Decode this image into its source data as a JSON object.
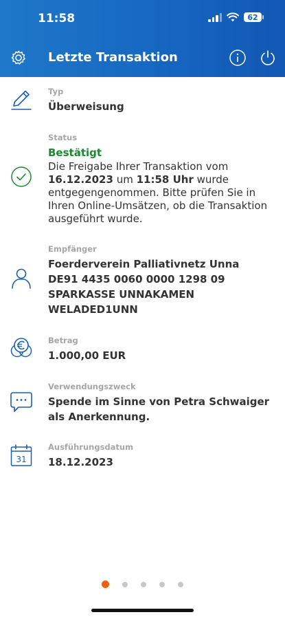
{
  "status_bar": {
    "time": "11:58",
    "battery": "62"
  },
  "header": {
    "title": "Letzte Transaktion"
  },
  "typ": {
    "label": "Typ",
    "value": "Überweisung"
  },
  "status": {
    "label": "Status",
    "value": "Bestätigt",
    "text_1": "Die Freigabe Ihrer Transaktion vom",
    "date": "16.12.2023",
    "text_2": "um",
    "time": "11:58 Uhr",
    "text_3": "wurde",
    "line_3": "entgegengenommen. Bitte prüfen Sie in",
    "line_4": "Ihren Online-Umsätzen, ob die Transaktion",
    "line_5": "ausgeführt wurde."
  },
  "empfaenger": {
    "label": "Empfänger",
    "name": "Foerderverein Palliativnetz Unna",
    "iban": "DE91 4435 0060 0000 1298 09",
    "bank": "SPARKASSE UNNAKAMEN",
    "bic": "WELADED1UNN"
  },
  "betrag": {
    "label": "Betrag",
    "value": "1.000,00 EUR"
  },
  "verwendungszweck": {
    "label": "Verwendungszweck",
    "line_1": "Spende im Sinne von Petra Schwaiger",
    "line_2": "als Anerkennung."
  },
  "ausfuehrungsdatum": {
    "label": "Ausführungsdatum",
    "value": "18.12.2023",
    "calendar_day": "31"
  },
  "pager": {
    "pages": 5,
    "active_index": 0
  },
  "colors": {
    "header": "#1565c0",
    "accent_icon": "#1a5fb4",
    "status_green": "#1a8a2e",
    "active_dot": "#e8620c"
  }
}
